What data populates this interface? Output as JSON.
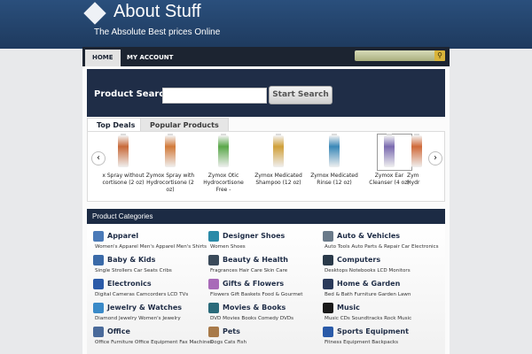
{
  "site": {
    "title": "About Stuff",
    "tagline": "The Absolute Best prices Online"
  },
  "nav": {
    "items": [
      {
        "label": "HOME",
        "active": true
      },
      {
        "label": "MY ACCOUNT",
        "active": false
      }
    ],
    "search_icon": "search-icon"
  },
  "search": {
    "label": "Product Search",
    "input_value": "",
    "button_label": "Start Search"
  },
  "tabs": [
    {
      "label": "Top Deals",
      "active": true
    },
    {
      "label": "Popular Products",
      "active": false
    }
  ],
  "carousel": {
    "left_arrow": "‹",
    "right_arrow": "›",
    "products": [
      {
        "label": "x Spray without cortisone (2 oz)",
        "color": "#c86a3a"
      },
      {
        "label": "Zymox Spray with Hydrocortisone (2 oz)",
        "color": "#d27a3a"
      },
      {
        "label": "Zymox Otic Hydrocortisone Free -",
        "color": "#5aa84a"
      },
      {
        "label": "Zymox Medicated Shampoo (12 oz)",
        "color": "#d0a03a"
      },
      {
        "label": "Zymox Medicated Rinse (12 oz)",
        "color": "#3a88b8"
      },
      {
        "label": "Zymox Ear Cleanser (4 oz)",
        "color": "#7a6ab0"
      },
      {
        "label": "Zym Hydr",
        "color": "#d06a3a"
      }
    ]
  },
  "categories": {
    "header": "Product Categories",
    "items": [
      {
        "title": "Apparel",
        "sub": "Women's Apparel Men's Apparel Men's Shirts",
        "icon": "shirt-icon",
        "color": "#4a7ab8"
      },
      {
        "title": "Designer Shoes",
        "sub": "Women Shoes",
        "icon": "shoe-icon",
        "color": "#2a8aa8"
      },
      {
        "title": "Auto & Vehicles",
        "sub": "Auto Tools Auto Parts & Repair Car Electronics",
        "icon": "car-icon",
        "color": "#6a7a8a"
      },
      {
        "title": "Baby & Kids",
        "sub": "Single Strollers Car Seats Cribs",
        "icon": "stroller-icon",
        "color": "#3a6aa8"
      },
      {
        "title": "Beauty & Health",
        "sub": "Fragrances Hair Care Skin Care",
        "icon": "beauty-icon",
        "color": "#3a4a5a"
      },
      {
        "title": "Computers",
        "sub": "Desktops Notebooks LCD Monitors",
        "icon": "computer-icon",
        "color": "#2a3a4a"
      },
      {
        "title": "Electronics",
        "sub": "Digital Cameras Camcorders LCD TVs",
        "icon": "tv-icon",
        "color": "#2a5aa8"
      },
      {
        "title": "Gifts & Flowers",
        "sub": "Flowers Gift Baskets Food & Gourmet",
        "icon": "flower-icon",
        "color": "#a86ab8"
      },
      {
        "title": "Home & Garden",
        "sub": "Bed & Bath Furniture Garden Lawn",
        "icon": "home-icon",
        "color": "#2a3a5a"
      },
      {
        "title": "Jewelry & Watches",
        "sub": "Diamond Jewelry Women's Jewelry",
        "icon": "diamond-icon",
        "color": "#3a8ac8"
      },
      {
        "title": "Movies & Books",
        "sub": "DVD Movies Books Comedy DVDs",
        "icon": "film-icon",
        "color": "#2a6a7a"
      },
      {
        "title": "Music",
        "sub": "Music CDs Soundtracks Rock Music",
        "icon": "music-icon",
        "color": "#1a1a1a"
      },
      {
        "title": "Office",
        "sub": "Office Furniture Office Equipment Fax Machines",
        "icon": "office-icon",
        "color": "#4a6a9a"
      },
      {
        "title": "Pets",
        "sub": "Dogs Cats Fish",
        "icon": "paw-icon",
        "color": "#a87a4a"
      },
      {
        "title": "Sports Equipment",
        "sub": "Fitness Equipment Backpacks",
        "icon": "sports-icon",
        "color": "#2a5aa8"
      }
    ]
  }
}
